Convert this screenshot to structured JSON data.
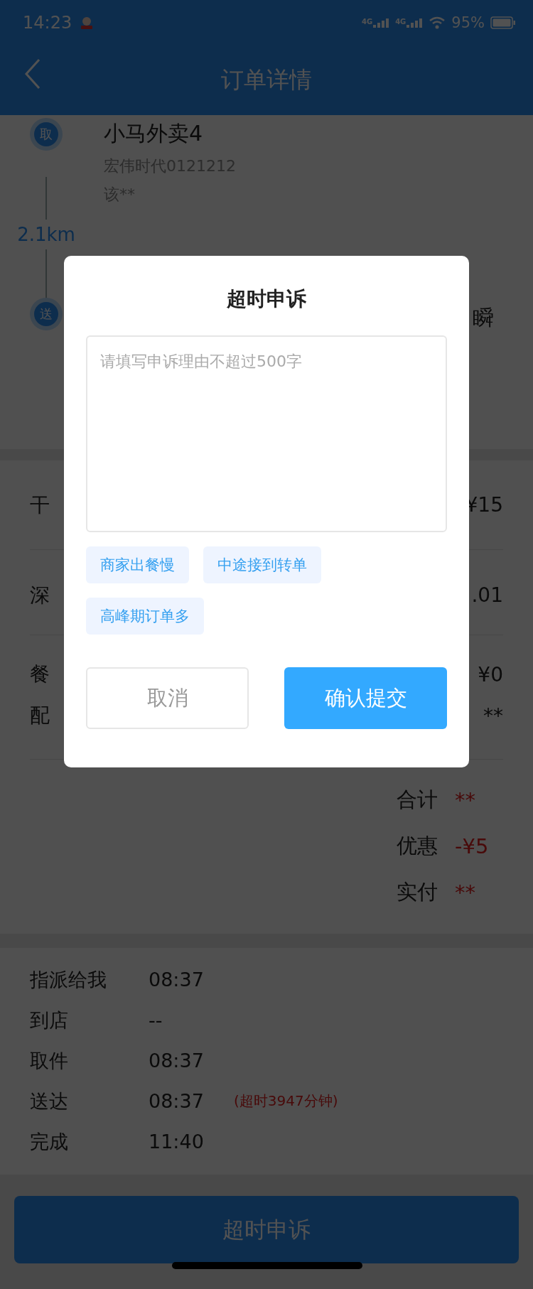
{
  "status_bar": {
    "time": "14:23",
    "network_1": "4G",
    "network_2": "4G",
    "battery": "95%"
  },
  "header": {
    "title": "订单详情"
  },
  "route": {
    "pickup": {
      "badge": "取",
      "name": "小马外卖4",
      "address": "宏伟时代0121212",
      "note": "该**"
    },
    "distance": "2.1km",
    "dropoff": {
      "badge": "送",
      "name": "瞬"
    }
  },
  "items": [
    {
      "name": "干",
      "price": "¥15"
    },
    {
      "name": "深",
      "price": ".01"
    }
  ],
  "fees": [
    {
      "label": "餐",
      "value": "¥0"
    },
    {
      "label": "配",
      "value": "**"
    }
  ],
  "totals": [
    {
      "label": "合计",
      "value": "**"
    },
    {
      "label": "优惠",
      "value": "-¥5"
    },
    {
      "label": "实付",
      "value": "**"
    }
  ],
  "timeline": [
    {
      "label": "指派给我",
      "time": "08:37"
    },
    {
      "label": "到店",
      "time": "--"
    },
    {
      "label": "取件",
      "time": "08:37"
    },
    {
      "label": "送达",
      "time": "08:37",
      "note": "(超时3947分钟)"
    },
    {
      "label": "完成",
      "time": "11:40"
    }
  ],
  "appeal_button": {
    "label": "超时申诉"
  },
  "dialog": {
    "title": "超时申诉",
    "reason_field": {
      "placeholder": "请填写申诉理由不超过500字"
    },
    "chips": [
      "商家出餐慢",
      "中途接到转单",
      "高峰期订单多"
    ],
    "cancel_button": "取消",
    "confirm_button": "确认提交"
  }
}
